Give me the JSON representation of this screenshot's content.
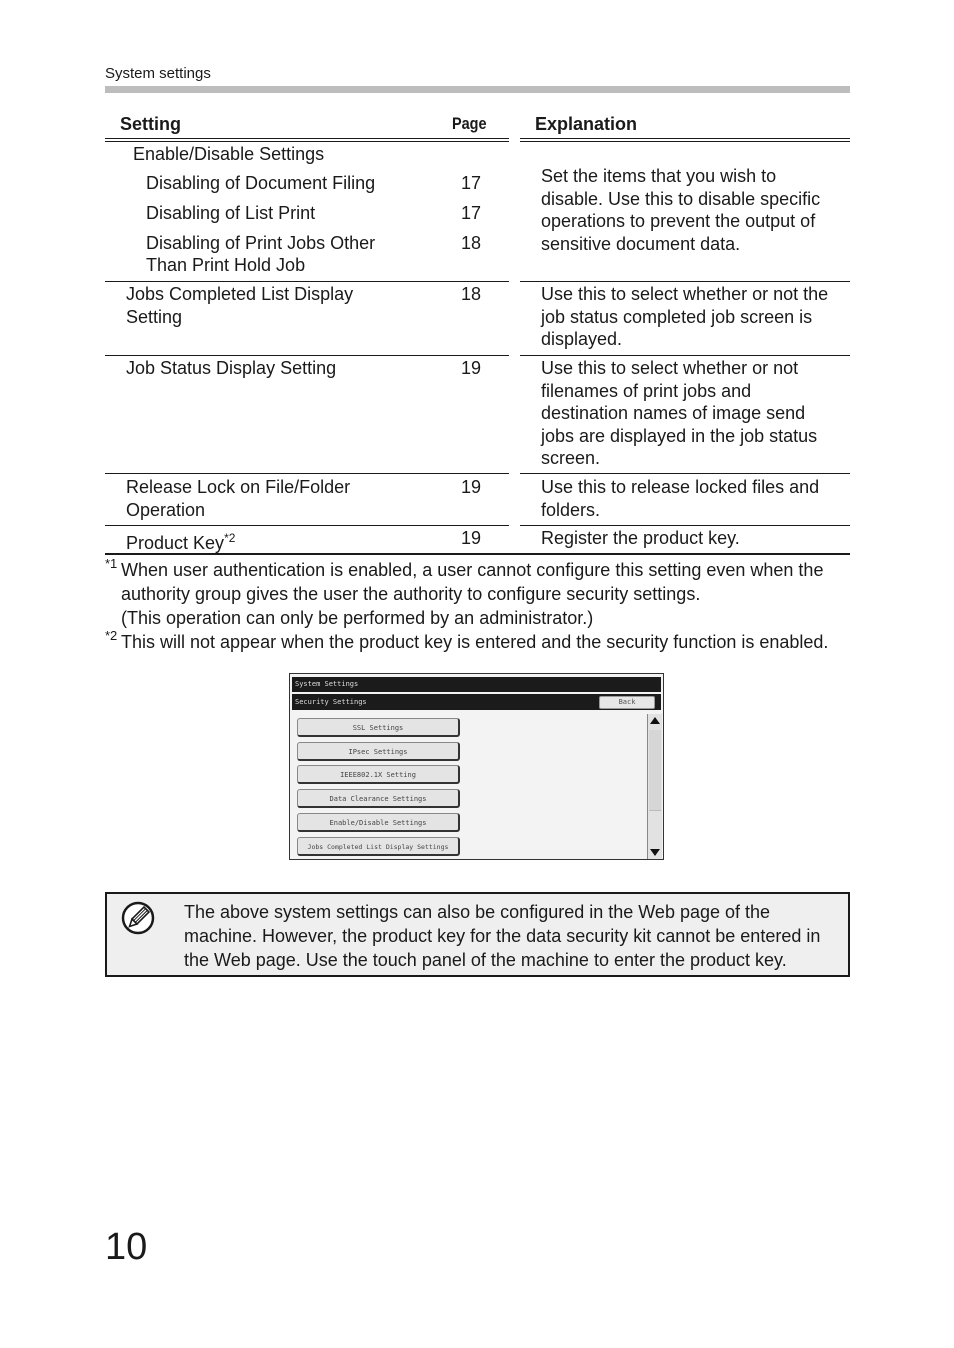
{
  "running_head": "System settings",
  "table": {
    "headers": {
      "setting": "Setting",
      "page": "Page",
      "explanation": "Explanation"
    },
    "group": {
      "label": "Enable/Disable Settings",
      "items": [
        {
          "setting": "Disabling of Document Filing",
          "page": "17"
        },
        {
          "setting": "Disabling of List Print",
          "page": "17"
        },
        {
          "setting_line1": "Disabling of Print Jobs Other",
          "setting_line2": "Than Print Hold Job",
          "page": "18"
        }
      ],
      "explanation": "Set the items that you wish to disable. Use this to disable specific operations to prevent the output of sensitive document data."
    },
    "rows": [
      {
        "setting": "Jobs Completed List Display Setting",
        "page": "18",
        "explanation": "Use this to select whether or not the job status completed job screen is displayed."
      },
      {
        "setting": "Job Status Display Setting",
        "page": "19",
        "explanation": "Use this to select whether or not filenames of print jobs and destination names of image send jobs are displayed in the job status screen."
      },
      {
        "setting": "Release Lock on File/Folder Operation",
        "page": "19",
        "explanation": "Use this to release locked files and folders."
      },
      {
        "setting": "Product Key",
        "setting_sup": "*2",
        "page": "19",
        "explanation": "Register the product key."
      }
    ]
  },
  "footnotes": [
    {
      "mark": "*1",
      "text": "When user authentication is enabled, a user cannot configure this setting even when the authority group gives the user the authority to configure security settings.",
      "text2": "(This operation can only be performed by an administrator.)"
    },
    {
      "mark": "*2",
      "text": "This will not appear when the product key is entered and the security function is enabled."
    }
  ],
  "screen": {
    "title": "System Settings",
    "subtitle": "Security Settings",
    "back_label": "Back",
    "buttons": [
      "SSL Settings",
      "IPsec Settings",
      "IEEE802.1X Setting",
      "Data Clearance Settings",
      "Enable/Disable Settings",
      "Jobs Completed List Display Settings"
    ]
  },
  "note": {
    "icon": "pencil-note-icon",
    "text": "The above system settings can also be configured in the Web page of the machine. However, the product key for the data security kit cannot be entered in the Web page. Use the touch panel of the machine to enter the product key."
  },
  "page_number": "10"
}
